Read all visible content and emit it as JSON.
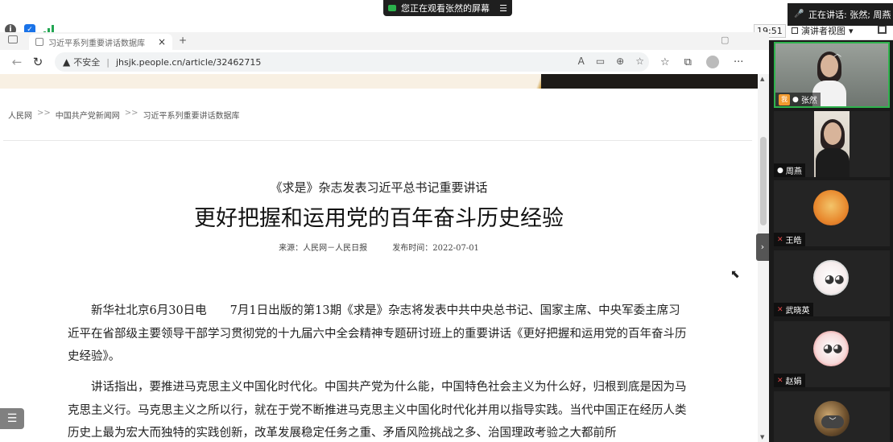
{
  "meeting": {
    "share_banner": "您正在观看张然的屏幕",
    "share_menu_icon": "☰",
    "speaking": "正在讲话: 张然; 周燕",
    "timer": "19:51",
    "speaker_view": "演讲者视图",
    "speaker_view_caret": "▾"
  },
  "browser": {
    "tab_title": "习近平系列重要讲话数据库",
    "tab_close": "×",
    "new_tab": "+",
    "insecure_label": "不安全",
    "url": "jhsjk.people.cn/article/32462715",
    "menu_icon": "···"
  },
  "page": {
    "breadcrumb": [
      "人民网",
      "中国共产党新闻网",
      "习近平系列重要讲话数据库"
    ],
    "breadcrumb_sep": ">>",
    "subtitle": "《求是》杂志发表习近平总书记重要讲话",
    "title": "更好把握和运用党的百年奋斗历史经验",
    "source": "来源：人民网－人民日报",
    "publish_time": "发布时间：2022-07-01",
    "paragraphs": [
      "新华社北京6月30日电　　7月1日出版的第13期《求是》杂志将发表中共中央总书记、国家主席、中央军委主席习近平在省部级主要领导干部学习贯彻党的十九届六中全会精神专题研讨班上的重要讲话《更好把握和运用党的百年奋斗历史经验》。",
      "讲话指出，要推进马克思主义中国化时代化。中国共产党为什么能，中国特色社会主义为什么好，归根到底是因为马克思主义行。马克思主义之所以行，就在于党不断推进马克思主义中国化时代化并用以指导实践。当代中国正在经历人类历史上最为宏大而独特的实践创新，改革发展稳定任务之重、矛盾风险挑战之多、治国理政考验之大都前所"
    ]
  },
  "participants": [
    {
      "name": "张然",
      "mic": "on",
      "me": true,
      "me_label": "我",
      "active": true
    },
    {
      "name": "周燕",
      "mic": "on"
    },
    {
      "name": "王皓",
      "mic": "off"
    },
    {
      "name": "武晓英",
      "mic": "off"
    },
    {
      "name": "赵娟",
      "mic": "off"
    }
  ],
  "colors": {
    "active_border": "#2fb34d",
    "muted": "#e34848",
    "brand_green": "#2bb24c"
  }
}
